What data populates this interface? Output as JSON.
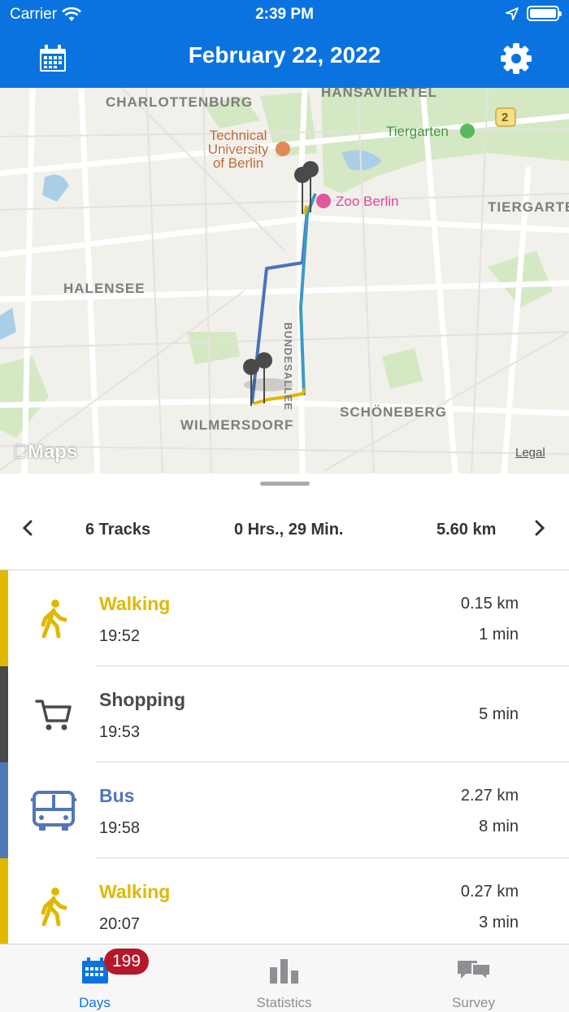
{
  "status_bar": {
    "carrier": "Carrier",
    "time": "2:39 PM"
  },
  "header": {
    "title": "February 22, 2022",
    "calendar_icon": "calendar-icon",
    "settings_icon": "gear-icon"
  },
  "map": {
    "labels": {
      "charlottenburg": "CHARLOTTENBURG",
      "hansaviertel": "HANSAVIERTEL",
      "tiergarten_district": "TIERGARTEN",
      "halensee": "HALENSEE",
      "wilmersdorf": "WILMERSDORF",
      "schoeneberg": "SCHÖNEBERG",
      "bundesallee": "BUNDESALLEE",
      "route_shield": "2"
    },
    "pois": {
      "tu_berlin_line1": "Technical",
      "tu_berlin_line2": "University",
      "tu_berlin_line3": "of Berlin",
      "tiergarten_park": "Tiergarten",
      "zoo_berlin": "Zoo Berlin"
    },
    "attribution": "Maps",
    "legal": "Legal"
  },
  "summary": {
    "tracks": "6 Tracks",
    "duration": "0 Hrs., 29 Min.",
    "distance": "5.60 km"
  },
  "tracks": [
    {
      "mode": "Walking",
      "time": "19:52",
      "distance": "0.15 km",
      "duration": "1 min",
      "color": "#e0b800",
      "icon": "walking-icon"
    },
    {
      "mode": "Shopping",
      "time": "19:53",
      "distance": "",
      "duration": "5 min",
      "color": "#4a4a4a",
      "icon": "shopping-cart-icon"
    },
    {
      "mode": "Bus",
      "time": "19:58",
      "distance": "2.27 km",
      "duration": "8 min",
      "color": "#5277b8",
      "icon": "bus-icon"
    },
    {
      "mode": "Walking",
      "time": "20:07",
      "distance": "0.27 km",
      "duration": "3 min",
      "color": "#e0b800",
      "icon": "walking-icon"
    }
  ],
  "tabbar": {
    "days": {
      "label": "Days",
      "badge": "199"
    },
    "statistics": {
      "label": "Statistics"
    },
    "survey": {
      "label": "Survey"
    }
  },
  "colors": {
    "accent": "#0a73e0",
    "walking": "#e0b800",
    "bus": "#5277b8",
    "shopping": "#4a4a4a",
    "badge": "#b5182a"
  }
}
